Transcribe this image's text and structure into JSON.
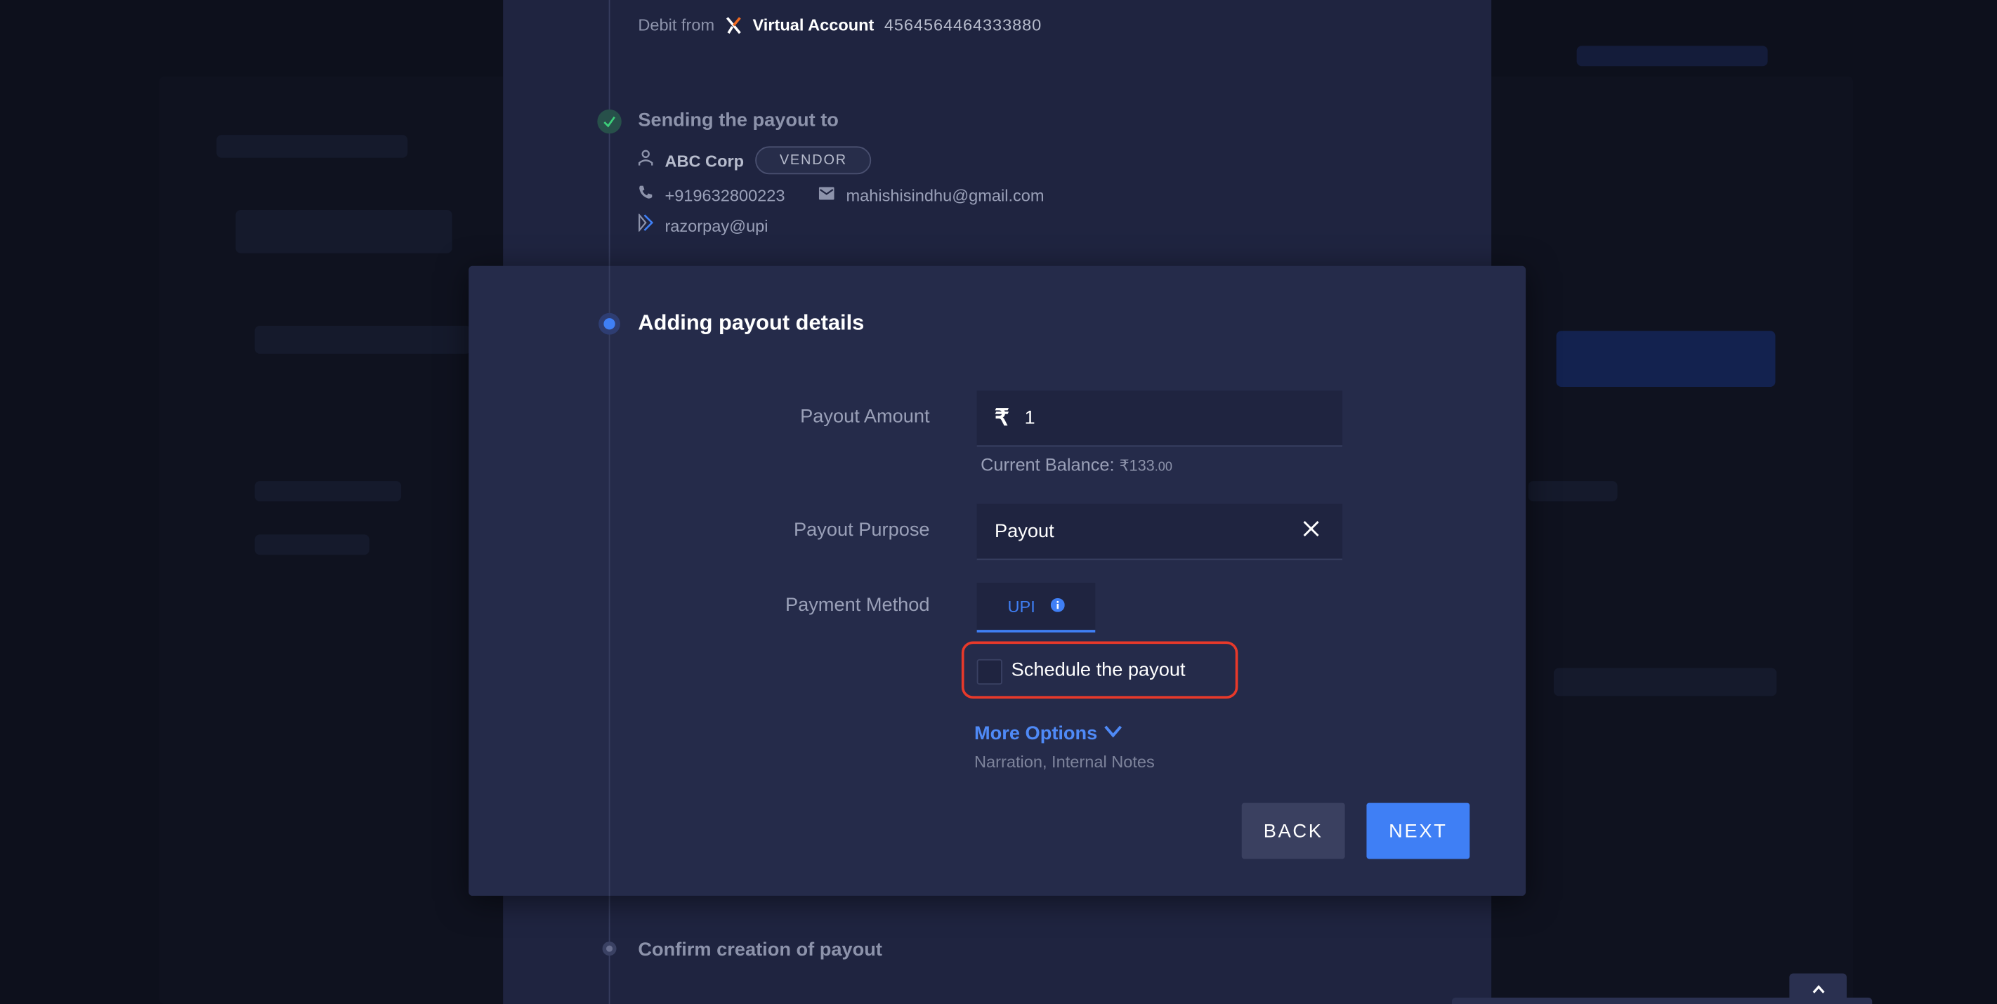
{
  "debit": {
    "label": "Debit from",
    "account_name": "Virtual Account",
    "account_number": "4564564464333880"
  },
  "step_sending": {
    "title": "Sending the payout to",
    "contact_name": "ABC Corp",
    "badge": "VENDOR",
    "phone": "+919632800223",
    "email": "mahishisindhu@gmail.com",
    "vpa": "razorpay@upi"
  },
  "step_adding": {
    "title": "Adding payout details",
    "amount_label": "Payout Amount",
    "currency_symbol": "₹",
    "amount_value": "1",
    "balance_label": "Current Balance:",
    "balance_value": "₹133",
    "balance_decimals": ".00",
    "purpose_label": "Payout Purpose",
    "purpose_value": "Payout",
    "method_label": "Payment Method",
    "method_value": "UPI",
    "schedule_label": "Schedule the payout",
    "more_options": "More Options",
    "more_options_hint": "Narration, Internal Notes",
    "back": "BACK",
    "next": "NEXT"
  },
  "step_confirm": {
    "title": "Confirm creation of payout"
  },
  "colors": {
    "accent": "#3f7ff5",
    "success": "#3ccf7a",
    "highlight": "#e8392a",
    "modal_bg": "#252b4a",
    "panel_bg": "#1f2440"
  }
}
